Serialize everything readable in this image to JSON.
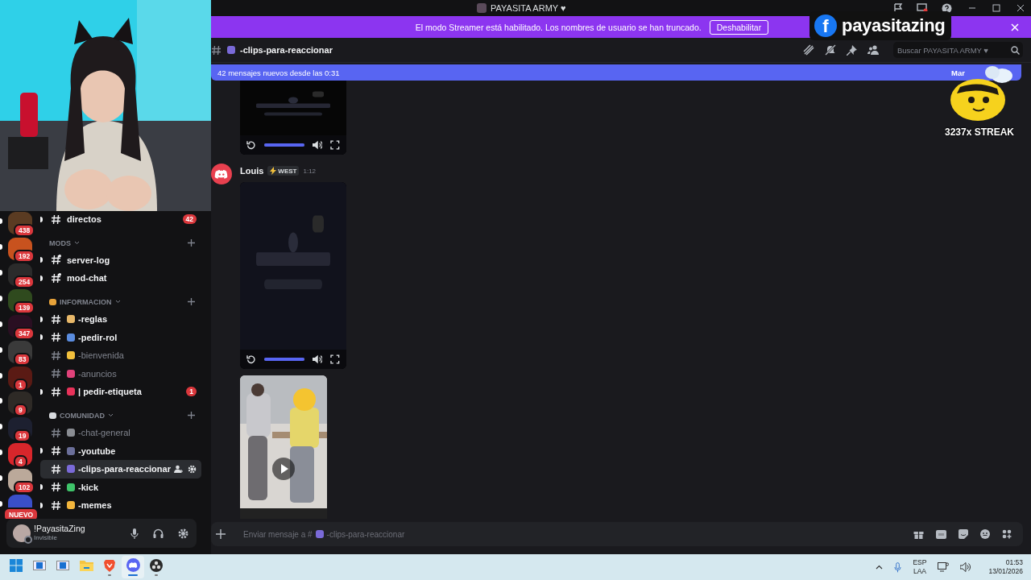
{
  "window": {
    "title": "PAYASITA ARMY ♥"
  },
  "streamer_banner": {
    "text": "El modo Streamer está habilitado. Los nombres de usuario se han truncado.",
    "button": "Deshabilitar"
  },
  "servers": [
    {
      "badge": "438",
      "color": "#5a3b22",
      "unread": true
    },
    {
      "badge": "192",
      "color": "#c8521e",
      "unread": true
    },
    {
      "badge": "254",
      "color": "#2b2b2b",
      "unread": true
    },
    {
      "badge": "139",
      "color": "#2f4a1e",
      "unread": true
    },
    {
      "badge": "347",
      "color": "#2a0f22",
      "unread": true
    },
    {
      "badge": "83",
      "color": "#3a3a3a",
      "unread": true
    },
    {
      "badge": "1",
      "color": "#5a1a14",
      "unread": true
    },
    {
      "badge": "9",
      "color": "#2e2a26",
      "unread": true
    },
    {
      "badge": "19",
      "color": "#1d2030",
      "unread": true
    },
    {
      "badge": "4",
      "color": "#d8262b",
      "unread": true
    },
    {
      "badge": "102",
      "color": "#bba99a",
      "unread": true
    },
    {
      "badge": "NUEVO",
      "color": "#3a4fc8",
      "unread": true
    }
  ],
  "top_channels": [
    {
      "name": "directos",
      "private": false,
      "unread": true,
      "selected": false,
      "badge": "42"
    }
  ],
  "categories": [
    {
      "name": "MODS",
      "channels": [
        {
          "name": "server-log",
          "private": true,
          "unread": true,
          "selected": false
        },
        {
          "name": "mod-chat",
          "private": true,
          "unread": true,
          "selected": false
        }
      ]
    },
    {
      "name": "INFORMACION",
      "color": "#e8a33a",
      "channels": [
        {
          "name": "-reglas",
          "color": "#e8b86a",
          "private": false,
          "unread": true,
          "selected": false
        },
        {
          "name": "-pedir-rol",
          "color": "#5b8de0",
          "private": false,
          "unread": true,
          "selected": false
        },
        {
          "name": "-bienvenida",
          "color": "#f2c03c",
          "private": false,
          "unread": false,
          "selected": false
        },
        {
          "name": "-anuncios",
          "color": "#e0427a",
          "private": false,
          "unread": false,
          "selected": false
        },
        {
          "name": "| pedir-etiqueta",
          "color": "#e8325a",
          "private": false,
          "unread": true,
          "selected": false,
          "badge": "1"
        }
      ]
    },
    {
      "name": "COMUNIDAD",
      "color": "#d8dade",
      "channels": [
        {
          "name": "-chat-general",
          "color": "#8a8d93",
          "private": false,
          "unread": false,
          "selected": false
        },
        {
          "name": "-youtube",
          "color": "#6b6f9a",
          "private": false,
          "unread": true,
          "selected": false
        },
        {
          "name": "-clips-para-reaccionar",
          "color": "#7a6ad8",
          "private": false,
          "unread": false,
          "selected": true
        },
        {
          "name": "-kick",
          "color": "#3fc46a",
          "private": false,
          "unread": true,
          "selected": false
        },
        {
          "name": "-memes",
          "color": "#f2b53c",
          "private": false,
          "unread": true,
          "selected": false
        }
      ]
    }
  ],
  "user": {
    "name": "!PayasitaZing",
    "status": "Invisible"
  },
  "channel_header": {
    "name": "-clips-para-reaccionar"
  },
  "search": {
    "placeholder": "Buscar PAYASITA ARMY ♥"
  },
  "new_messages_bar": {
    "text": "42 mensajes nuevos desde las 0:31",
    "action": "Mar"
  },
  "messages": [
    {
      "attachments": [
        {
          "kind": "video",
          "cut_top": true,
          "level": 1
        }
      ]
    },
    {
      "author": "Louis",
      "tag": "WEST",
      "time": "1:12",
      "attachments": [
        {
          "kind": "video",
          "cut_top": false,
          "level": 1
        },
        {
          "kind": "clip"
        }
      ]
    }
  ],
  "composer": {
    "placeholder_prefix": "Enviar mensaje a #",
    "placeholder_channel": "-clips-para-reaccionar"
  },
  "overlays": {
    "social_letter": "f",
    "social_handle": "payasitazing",
    "streak": "3237x STREAK"
  },
  "taskbar": {
    "apps": [
      {
        "kind": "start",
        "open": false,
        "selected": false
      },
      {
        "kind": "window",
        "open": false,
        "selected": false
      },
      {
        "kind": "window",
        "open": false,
        "selected": false
      },
      {
        "kind": "folder",
        "open": false,
        "selected": false
      },
      {
        "kind": "shield",
        "open": true,
        "selected": false
      },
      {
        "kind": "discord",
        "open": true,
        "selected": true
      },
      {
        "kind": "obs",
        "open": true,
        "selected": false
      }
    ],
    "language": "ESP",
    "layout": "LAA",
    "time": "01:53",
    "date": "13/01/2026"
  }
}
